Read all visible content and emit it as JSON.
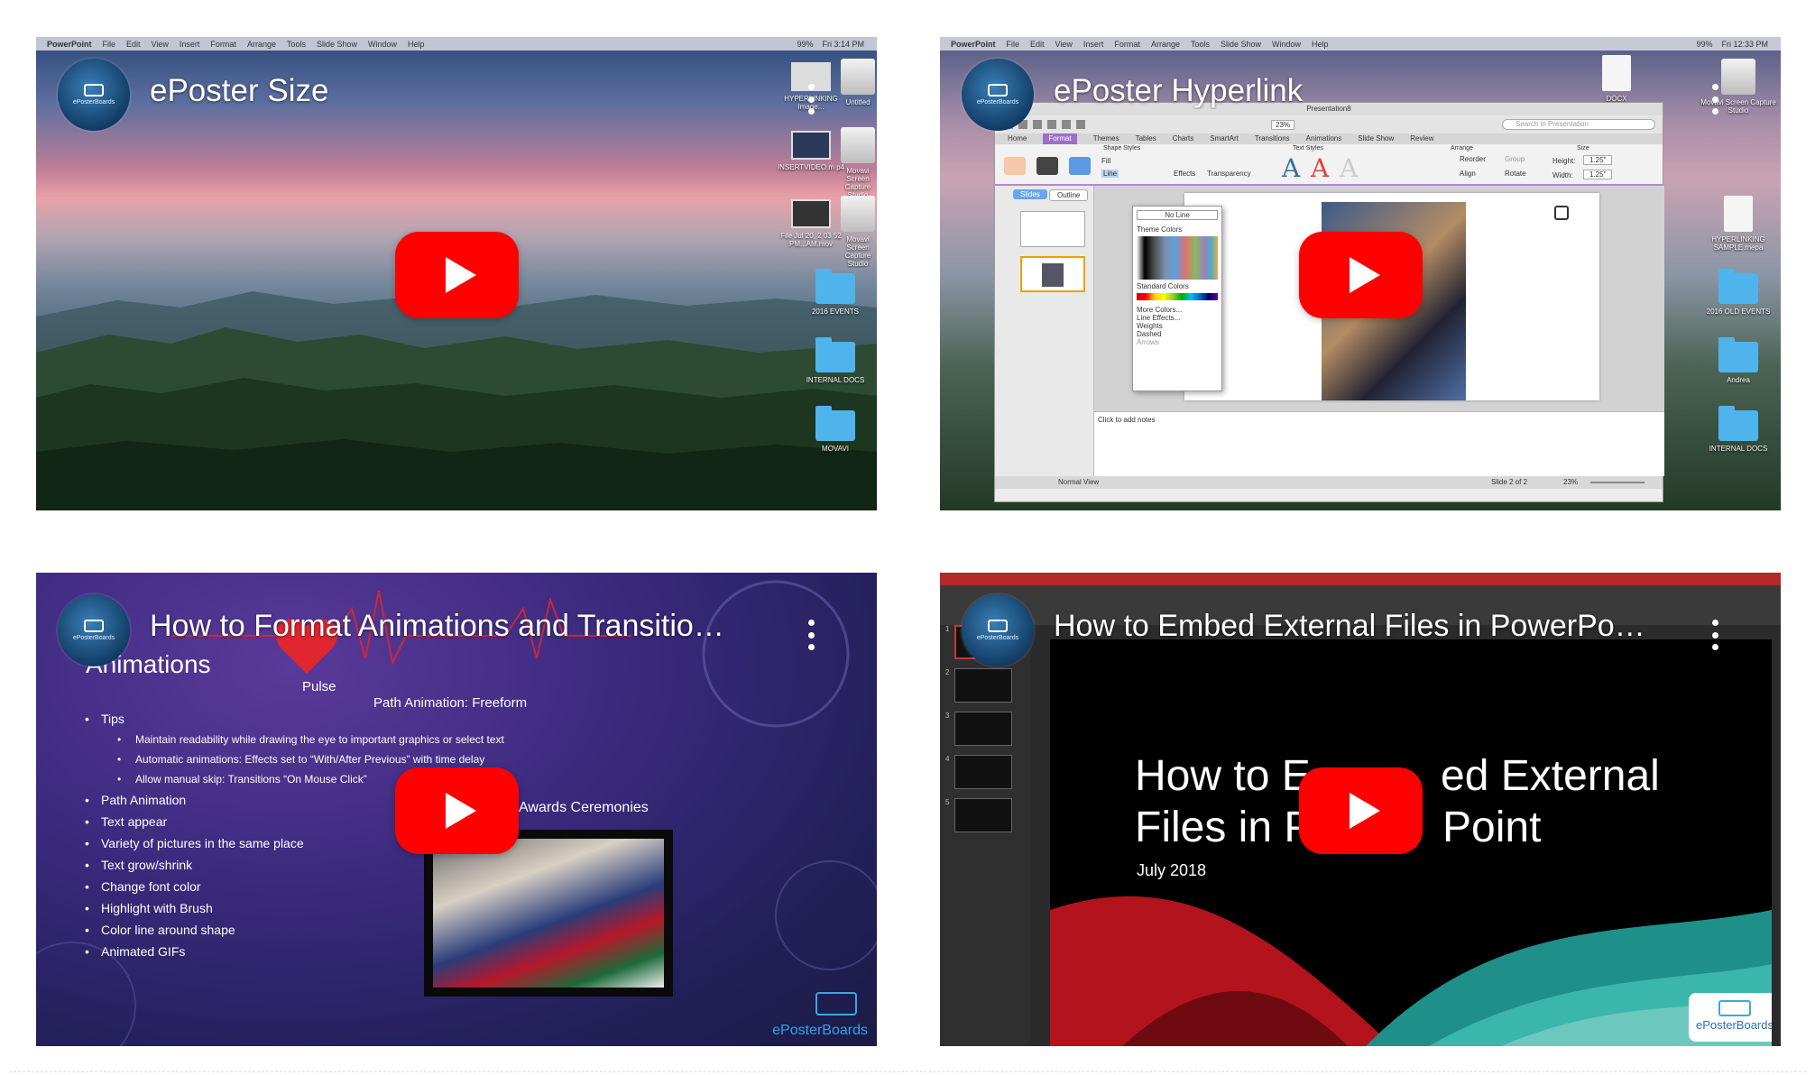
{
  "videos": [
    {
      "title": "ePoster Size",
      "channel": "ePosterBoards",
      "menubar": {
        "app": "PowerPoint",
        "items": [
          "File",
          "Edit",
          "View",
          "Insert",
          "Format",
          "Arrange",
          "Tools",
          "Slide Show",
          "Window",
          "Help"
        ],
        "clock": "Fri 3:14 PM",
        "battery": "99%"
      },
      "desktop_icons": [
        "HYPERLINKING Image...",
        "Untitled",
        "INSERTVIDEO.m p4",
        "Movavi Screen Capture Studio",
        "File Jul 20, 2 03 52 PM...AM.mov",
        "Movavi Screen Capture Studio",
        "2016 EVENTS",
        "INTERNAL DOCS",
        "MOVAVI"
      ]
    },
    {
      "title": "ePoster Hyperlink",
      "channel": "ePosterBoards",
      "menubar": {
        "app": "PowerPoint",
        "items": [
          "File",
          "Edit",
          "View",
          "Insert",
          "Format",
          "Arrange",
          "Tools",
          "Slide Show",
          "Window",
          "Help"
        ],
        "clock": "Fri 12:33 PM",
        "battery": "99%"
      },
      "ppt": {
        "doc_title": "Presentation8",
        "search_placeholder": "Search in Presentation",
        "zoom": "23%",
        "ribbon_tabs": [
          "Home",
          "Format",
          "Themes",
          "Tables",
          "Charts",
          "SmartArt",
          "Transitions",
          "Animations",
          "Slide Show",
          "Review"
        ],
        "groups": [
          "Shape Styles",
          "Text Styles",
          "Arrange",
          "Size"
        ],
        "buttons": [
          "Fill",
          "Line",
          "Effects",
          "Transparency",
          "Reorder",
          "Group",
          "Align",
          "Rotate"
        ],
        "size": {
          "height_label": "Height:",
          "height": "1.25\"",
          "width_label": "Width:",
          "width": "1.25\""
        },
        "pane_tabs": [
          "Slides",
          "Outline"
        ],
        "menu": {
          "no_line": "No Line",
          "theme_colors": "Theme Colors",
          "standard_colors": "Standard Colors",
          "items": [
            "More Colors...",
            "Line Effects...",
            "Weights",
            "Dashed",
            "Arrows"
          ]
        },
        "notes": "Click to add notes",
        "status": [
          "Normal View",
          "Slide 2 of 2",
          "23%"
        ]
      },
      "desktop_icons": [
        "DOCX",
        "Movavi Screen Capture Studio",
        "HYPERLINKING SAMPLE.mepa",
        "2016 OLD EVENTS",
        "Andrea",
        "INTERNAL DOCS"
      ]
    },
    {
      "title": "How to Format Animations and Transitio…",
      "channel": "ePosterBoards",
      "slide": {
        "heading": "Animations",
        "pulse": "Pulse",
        "path": "Path Animation: Freeform",
        "awards": "Awards Ceremonies",
        "bullets": [
          {
            "text": "Tips",
            "sub": false
          },
          {
            "text": "Maintain readability while drawing the eye to important graphics or select text",
            "sub": true
          },
          {
            "text": "Automatic animations: Effects set to “With/After Previous” with time delay",
            "sub": true
          },
          {
            "text": "Allow manual skip: Transitions “On Mouse Click”",
            "sub": true
          },
          {
            "text": "Path Animation",
            "sub": false
          },
          {
            "text": "Text appear",
            "sub": false
          },
          {
            "text": "Variety of pictures in the same place",
            "sub": false
          },
          {
            "text": "Text grow/shrink",
            "sub": false
          },
          {
            "text": "Change font color",
            "sub": false
          },
          {
            "text": "Highlight with Brush",
            "sub": false
          },
          {
            "text": "Color line around shape",
            "sub": false
          },
          {
            "text": "Animated GIFs",
            "sub": false
          }
        ],
        "brand": "ePosterBoards"
      }
    },
    {
      "title": "How to Embed External Files in PowerPo…",
      "channel": "ePosterBoards",
      "slide": {
        "line1a": "How to E",
        "line1b": "ed External",
        "line2a": "Files in P",
        "line2b": "Point",
        "date": "July 2018",
        "brand": "ePosterBoards"
      },
      "thumbs": [
        "1",
        "2",
        "3",
        "4",
        "5"
      ]
    }
  ],
  "colors": {
    "play": "#FF0000",
    "title": "#FFFFFF",
    "page": "#FFFFFF"
  }
}
